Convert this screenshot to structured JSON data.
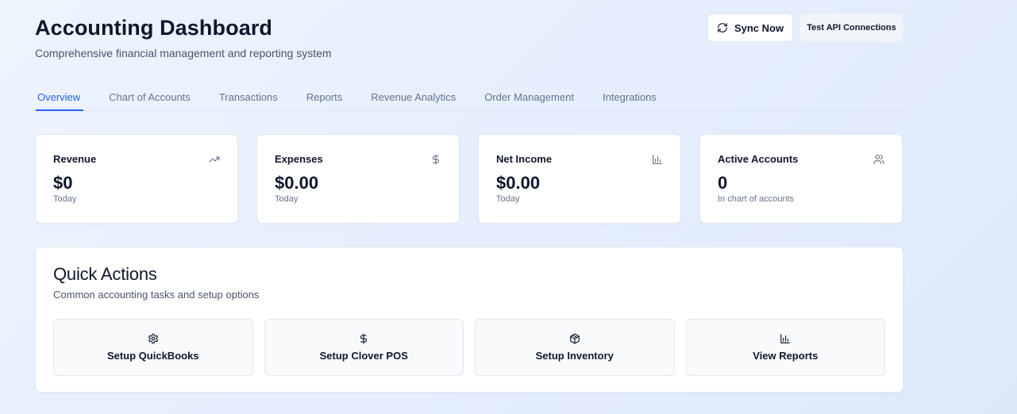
{
  "header": {
    "title": "Accounting Dashboard",
    "subtitle": "Comprehensive financial management and reporting system"
  },
  "actions": {
    "sync_label": "Sync Now",
    "sync_icon": "refresh-icon",
    "test_label": "Test API Connections"
  },
  "tabs": [
    {
      "label": "Overview",
      "active": true
    },
    {
      "label": "Chart of Accounts",
      "active": false
    },
    {
      "label": "Transactions",
      "active": false
    },
    {
      "label": "Reports",
      "active": false
    },
    {
      "label": "Revenue Analytics",
      "active": false
    },
    {
      "label": "Order Management",
      "active": false
    },
    {
      "label": "Integrations",
      "active": false
    }
  ],
  "stats": [
    {
      "title": "Revenue",
      "value": "$0",
      "sub": "Today",
      "icon": "trending-up-icon"
    },
    {
      "title": "Expenses",
      "value": "$0.00",
      "sub": "Today",
      "icon": "dollar-icon"
    },
    {
      "title": "Net Income",
      "value": "$0.00",
      "sub": "Today",
      "icon": "bar-chart-icon"
    },
    {
      "title": "Active Accounts",
      "value": "0",
      "sub": "In chart of accounts",
      "icon": "users-icon"
    }
  ],
  "quick_actions": {
    "title": "Quick Actions",
    "subtitle": "Common accounting tasks and setup options",
    "items": [
      {
        "label": "Setup QuickBooks",
        "icon": "gear-icon"
      },
      {
        "label": "Setup Clover POS",
        "icon": "dollar-icon"
      },
      {
        "label": "Setup Inventory",
        "icon": "package-icon"
      },
      {
        "label": "View Reports",
        "icon": "bar-chart-icon"
      }
    ]
  },
  "colors": {
    "accent": "#2563eb",
    "text": "#0f172a",
    "muted": "#64748b",
    "background": "#e8f0fd"
  }
}
